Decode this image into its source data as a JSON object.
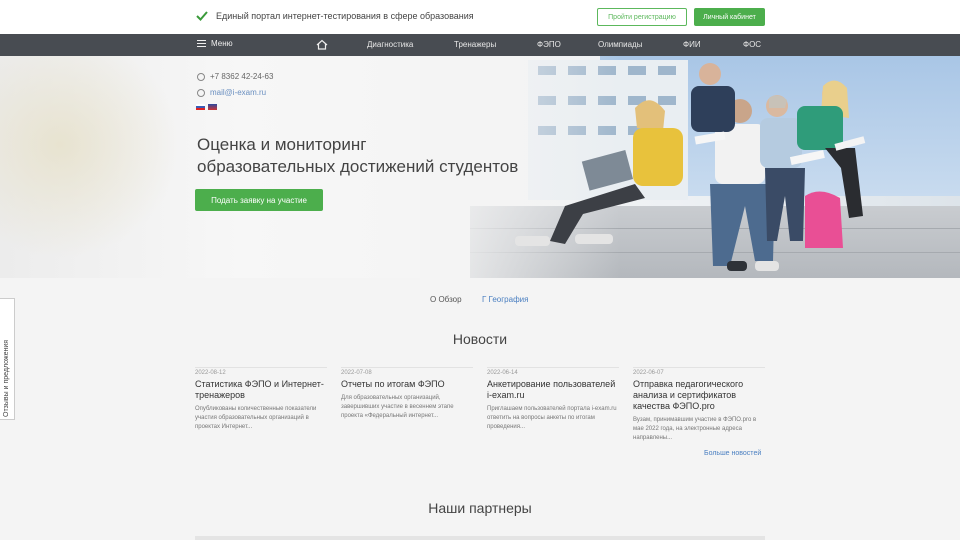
{
  "topbar": {
    "tagline": "Единый портал интернет-тестирования в сфере образования",
    "register_button": "Пройти регистрацию",
    "cabinet_button": "Личный кабинет"
  },
  "nav": {
    "menu_label": "Меню",
    "items": [
      "Диагностика",
      "Тренажеры",
      "ФЭПО",
      "Олимпиады",
      "ФИИ",
      "ФОС"
    ]
  },
  "hero": {
    "phone": "+7 8362 42-24-63",
    "email": "mail@i-exam.ru",
    "title_line1": "Оценка и мониторинг",
    "title_line2": "образовательных достижений студентов",
    "cta_button": "Подать заявку на участие"
  },
  "side_feedback": "Отзывы и предложения",
  "about_links": {
    "about": "О Обзор",
    "geography": "Г География"
  },
  "news": {
    "title": "Новости",
    "items": [
      {
        "date": "2022-08-12",
        "headline": "Статистика ФЭПО и Интернет-тренажеров",
        "body": "Опубликованы количественные показатели участия образовательных организаций в проектах Интернет..."
      },
      {
        "date": "2022-07-08",
        "headline": "Отчеты по итогам ФЭПО",
        "body": "Для образовательных организаций, завершивших участие в весеннем этапе проекта «Федеральный интернет..."
      },
      {
        "date": "2022-06-14",
        "headline": "Анкетирование пользователей i-exam.ru",
        "body": "Приглашаем пользователей портала i-exam.ru ответить на вопросы анкеты по итогам проведения..."
      },
      {
        "date": "2022-06-07",
        "headline": "Отправка педагогического анализа и сертификатов качества ФЭПО.pro",
        "body": "Вузам, принимавшим участие в ФЭПО.pro в мае 2022 года, на электронные адреса направлены..."
      }
    ],
    "more_link": "Больше новостей"
  },
  "partners_title": "Наши партнеры",
  "colors": {
    "accent_green": "#4cae4c",
    "nav_bg": "#484c52",
    "link_blue": "#4a7fc1"
  }
}
